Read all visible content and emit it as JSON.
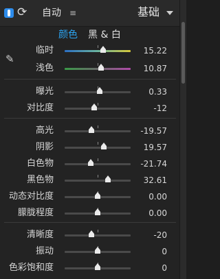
{
  "header": {
    "auto_label": "自动",
    "menu_glyph": "≡",
    "refresh_glyph": "⟳",
    "preset_label": "基础"
  },
  "mode": {
    "color_label": "颜色",
    "bw_label": "黑 & 白",
    "active": "color"
  },
  "icons": {
    "eyedropper_glyph": "✎"
  },
  "colors": {
    "accent": "#2ba4f2",
    "toggle": "#2d8ceb"
  },
  "wb": [
    {
      "name": "临时",
      "value": "15.22",
      "pos": 0.58
    },
    {
      "name": "浅色",
      "value": "10.87",
      "pos": 0.55
    }
  ],
  "tone": [
    {
      "name": "曝光",
      "value": "0.33",
      "pos": 0.53
    },
    {
      "name": "对比度",
      "value": "-12",
      "pos": 0.45
    }
  ],
  "tone2": [
    {
      "name": "高光",
      "value": "-19.57",
      "pos": 0.41
    },
    {
      "name": "阴影",
      "value": "19.57",
      "pos": 0.59
    },
    {
      "name": "白色物",
      "value": "-21.74",
      "pos": 0.4
    },
    {
      "name": "黑色物",
      "value": "32.61",
      "pos": 0.66
    },
    {
      "name": "动态对比度",
      "value": "0.00",
      "pos": 0.5
    },
    {
      "name": "朦胧程度",
      "value": "0.00",
      "pos": 0.5
    }
  ],
  "presence": [
    {
      "name": "清晰度",
      "value": "-20",
      "pos": 0.41
    },
    {
      "name": "振动",
      "value": "0",
      "pos": 0.5
    },
    {
      "name": "色彩饱和度",
      "value": "0",
      "pos": 0.5
    }
  ]
}
